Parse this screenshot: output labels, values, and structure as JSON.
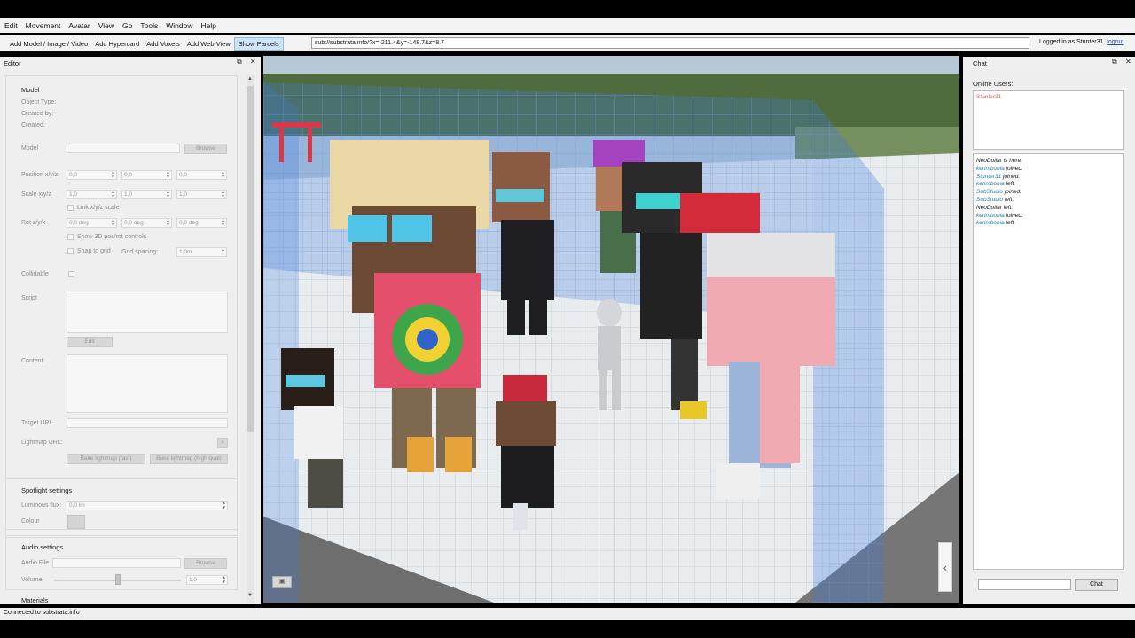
{
  "menu": [
    "Edit",
    "Movement",
    "Avatar",
    "View",
    "Go",
    "Tools",
    "Window",
    "Help"
  ],
  "toolbar": {
    "buttons": [
      "Add Model / Image / Video",
      "Add Hypercard",
      "Add Voxels",
      "Add Web View",
      "Show Parcels"
    ],
    "url": "sub://substrata.info/?x=-211.4&y=-148.7&z=8.7",
    "login_text": "Logged in as Stunter31.",
    "logout": "logout"
  },
  "editor": {
    "title": "Editor",
    "model_group": {
      "title": "Model",
      "object_type": "Object Type:",
      "created_by": "Created by:",
      "created": "Created:",
      "model_label": "Model",
      "browse": "Browse",
      "position_label": "Position x/y/z",
      "position": [
        "0,0",
        "0,0",
        "0,0"
      ],
      "scale_label": "Scale x/y/z",
      "scale": [
        "1,0",
        "1,0",
        "1,0"
      ],
      "link_scale": "Link x/y/z scale",
      "rot_label": "Rot z/y/x",
      "rot": [
        "0,0 deg",
        "0,0 deg",
        "0,0 deg"
      ],
      "show_3d": "Show 3D pos/rot controls",
      "snap": "Snap to grid",
      "grid_spacing_label": "Grid spacing:",
      "grid_spacing": "1,0m",
      "collidable": "Collidable",
      "script": "Script",
      "edit": "Edit",
      "content": "Content",
      "target_url": "Target URL",
      "lightmap_url": "Lightmap URL:",
      "bake_fast": "Bake lightmap (fast)",
      "bake_high": "Bake lightmap (high qual)"
    },
    "spotlight": {
      "title": "Spotlight settings",
      "flux_label": "Luminous flux:",
      "flux": "0,0 lm",
      "colour": "Colour"
    },
    "audio": {
      "title": "Audio settings",
      "file_label": "Audio File",
      "browse": "Browse",
      "volume_label": "Volume",
      "volume": "1,0"
    },
    "materials": "Materials"
  },
  "chat": {
    "title": "Chat",
    "online_label": "Online Users:",
    "online_users": [
      "Stunter31"
    ],
    "messages": [
      {
        "user": "NeoDollar",
        "text": "is here."
      },
      {
        "user": "kerimbonia",
        "text": "joined."
      },
      {
        "user": "Stunter31",
        "text": "joined."
      },
      {
        "user": "kerimbonia",
        "text": "left."
      },
      {
        "user": "SubStudio",
        "text": "joined."
      },
      {
        "user": "SubStudio",
        "text": "left."
      },
      {
        "user": "NeoDollar",
        "text": "left."
      },
      {
        "user": "kerimbonia",
        "text": "joined."
      },
      {
        "user": "kerimbonia",
        "text": "left."
      }
    ],
    "send": "Chat"
  },
  "status": "Connected to substrata.info"
}
